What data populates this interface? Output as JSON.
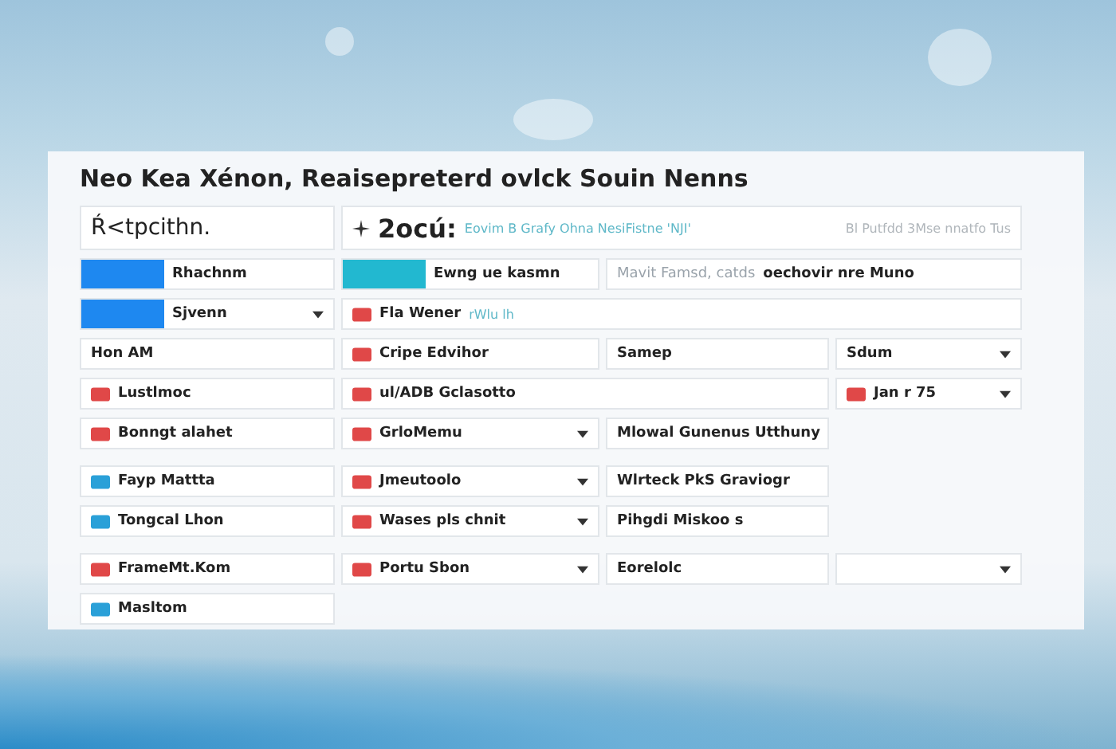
{
  "title": "Neo Kea Xénon, Reaisepreterd ovlck Souin Nenns",
  "rows": [
    {
      "cells": [
        {
          "kind": "header",
          "value": "Ŕ<tpcithn."
        },
        {
          "kind": "header-full",
          "value": "2ocú:",
          "note": "Eovim B Grafy Ohna NesiFistne 'NJI'",
          "hint": "Bl Putfdd 3Mse nnatfo Tus"
        }
      ]
    },
    {
      "cells": [
        {
          "kind": "swatch",
          "color": "#1e88f0",
          "value": "Rhachnm"
        },
        {
          "kind": "swatch",
          "color": "#22b8d0",
          "value": "Ewng ue kasmn"
        },
        {
          "kind": "field-wide",
          "hint": "Mavit Famsd, catds",
          "value": "oechovir nre Muno"
        }
      ]
    },
    {
      "cells": [
        {
          "kind": "swatch-select",
          "color": "#1e88f0",
          "value": "Sjvenn"
        },
        {
          "kind": "field-full",
          "color": "#e04848",
          "value": "Fla Wener",
          "note": "rWlu lh"
        }
      ]
    },
    {
      "cells": [
        {
          "kind": "field",
          "value": "Hon AM"
        },
        {
          "kind": "field",
          "color": "#e04848",
          "value": "Cripe Edvihor"
        },
        {
          "kind": "field",
          "value": "Samep"
        },
        {
          "kind": "select",
          "value": "Sdum"
        }
      ]
    },
    {
      "cells": [
        {
          "kind": "field",
          "color": "#e04848",
          "value": "Lustlmoc"
        },
        {
          "kind": "field-wide",
          "color": "#e04848",
          "value": "ul/ADB Gclasotto"
        },
        {
          "kind": "select",
          "color": "#e04848",
          "value": "Jan r 75"
        }
      ]
    },
    {
      "cells": [
        {
          "kind": "field",
          "color": "#e04848",
          "value": "Bonngt alahet"
        },
        {
          "kind": "select",
          "color": "#e04848",
          "value": "GrloMemu"
        },
        {
          "kind": "field",
          "value": "Mlowal Gunenus Utthuny"
        }
      ]
    },
    {
      "cells": [
        {
          "kind": "field",
          "color": "#2aa0d8",
          "value": "Fayp Mattta"
        },
        {
          "kind": "select",
          "color": "#e04848",
          "value": "Jmeutoolo"
        },
        {
          "kind": "field",
          "value": "Wlrteck PkS Graviogr"
        }
      ]
    },
    {
      "cells": [
        {
          "kind": "field",
          "color": "#2aa0d8",
          "value": "Tongcal Lhon"
        },
        {
          "kind": "select",
          "color": "#e04848",
          "value": "Wases pls chnit"
        },
        {
          "kind": "field",
          "value": "Pihgdi Miskoo s"
        }
      ]
    },
    {
      "cells": [
        {
          "kind": "field",
          "color": "#e04848",
          "value": "FrameMt.Kom"
        },
        {
          "kind": "select",
          "color": "#e04848",
          "value": "Portu Sbon"
        },
        {
          "kind": "field",
          "value": "Eorelolc"
        },
        {
          "kind": "select"
        }
      ]
    },
    {
      "cells": [
        {
          "kind": "field",
          "color": "#2aa0d8",
          "value": "Masltom"
        }
      ]
    }
  ]
}
